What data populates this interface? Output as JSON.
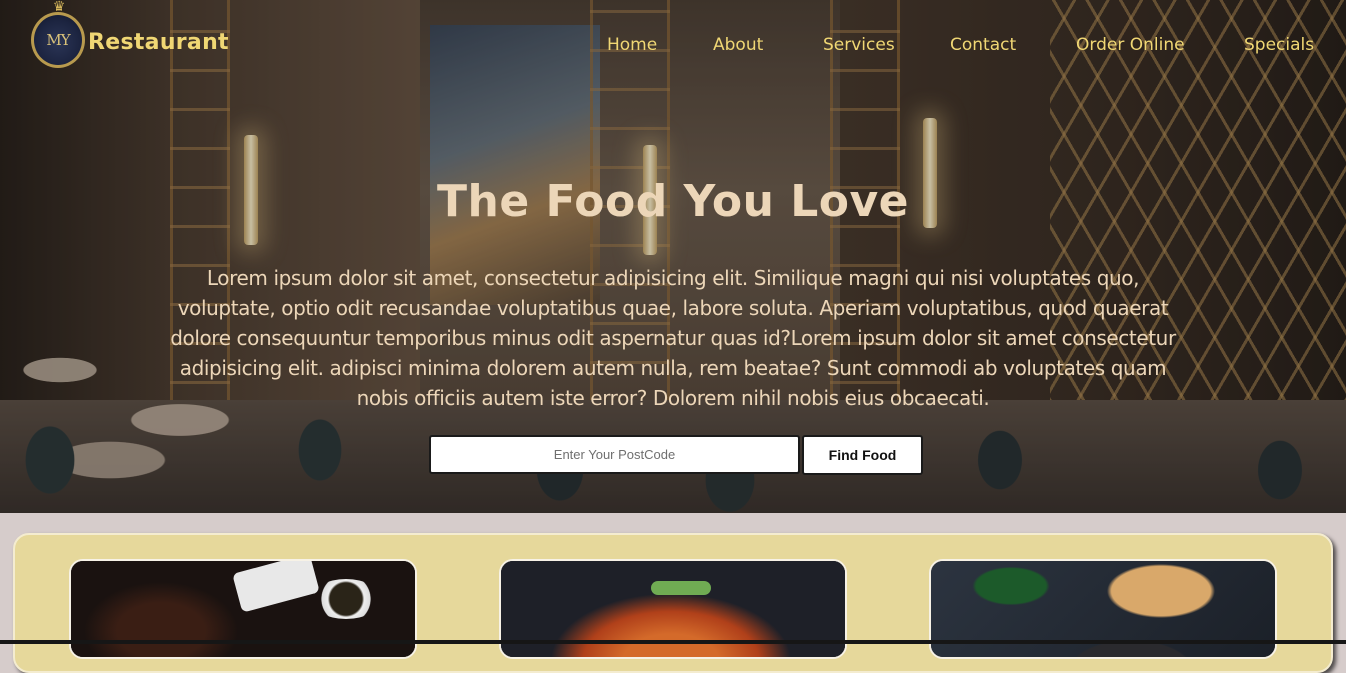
{
  "brand": {
    "monogram": "MY",
    "name": "Restaurant"
  },
  "nav": {
    "items": [
      "Home",
      "About",
      "Services",
      "Contact",
      "Order Online",
      "Specials"
    ]
  },
  "hero": {
    "title": "The Food You Love",
    "description": "Lorem ipsum dolor sit amet, consectetur adipisicing elit. Similique magni qui nisi voluptates quo, voluptate, optio odit recusandae voluptatibus quae, labore soluta. Aperiam voluptatibus, quod quaerat dolore consequuntur temporibus minus odit aspernatur quas id?Lorem ipsum dolor sit amet consectetur adipisicing elit. adipisci minima dolorem autem nulla, rem beatae? Sunt commodi ab voluptates quam nobis officiis autem iste error? Dolorem nihil nobis eius obcaecati.",
    "search": {
      "placeholder": "Enter Your PostCode",
      "value": ""
    },
    "find_button": "Find Food"
  },
  "colors": {
    "accent": "#f0d774",
    "hero_text": "#ecd6b8",
    "card_section_bg": "#e6d89b",
    "page_bg": "#d6cccb"
  },
  "cards": [
    {
      "image": "food-dish-dumplings-spring-rolls"
    },
    {
      "image": "food-dish-glazed-chicken"
    },
    {
      "image": "food-dish-fried-rice-curry"
    }
  ]
}
